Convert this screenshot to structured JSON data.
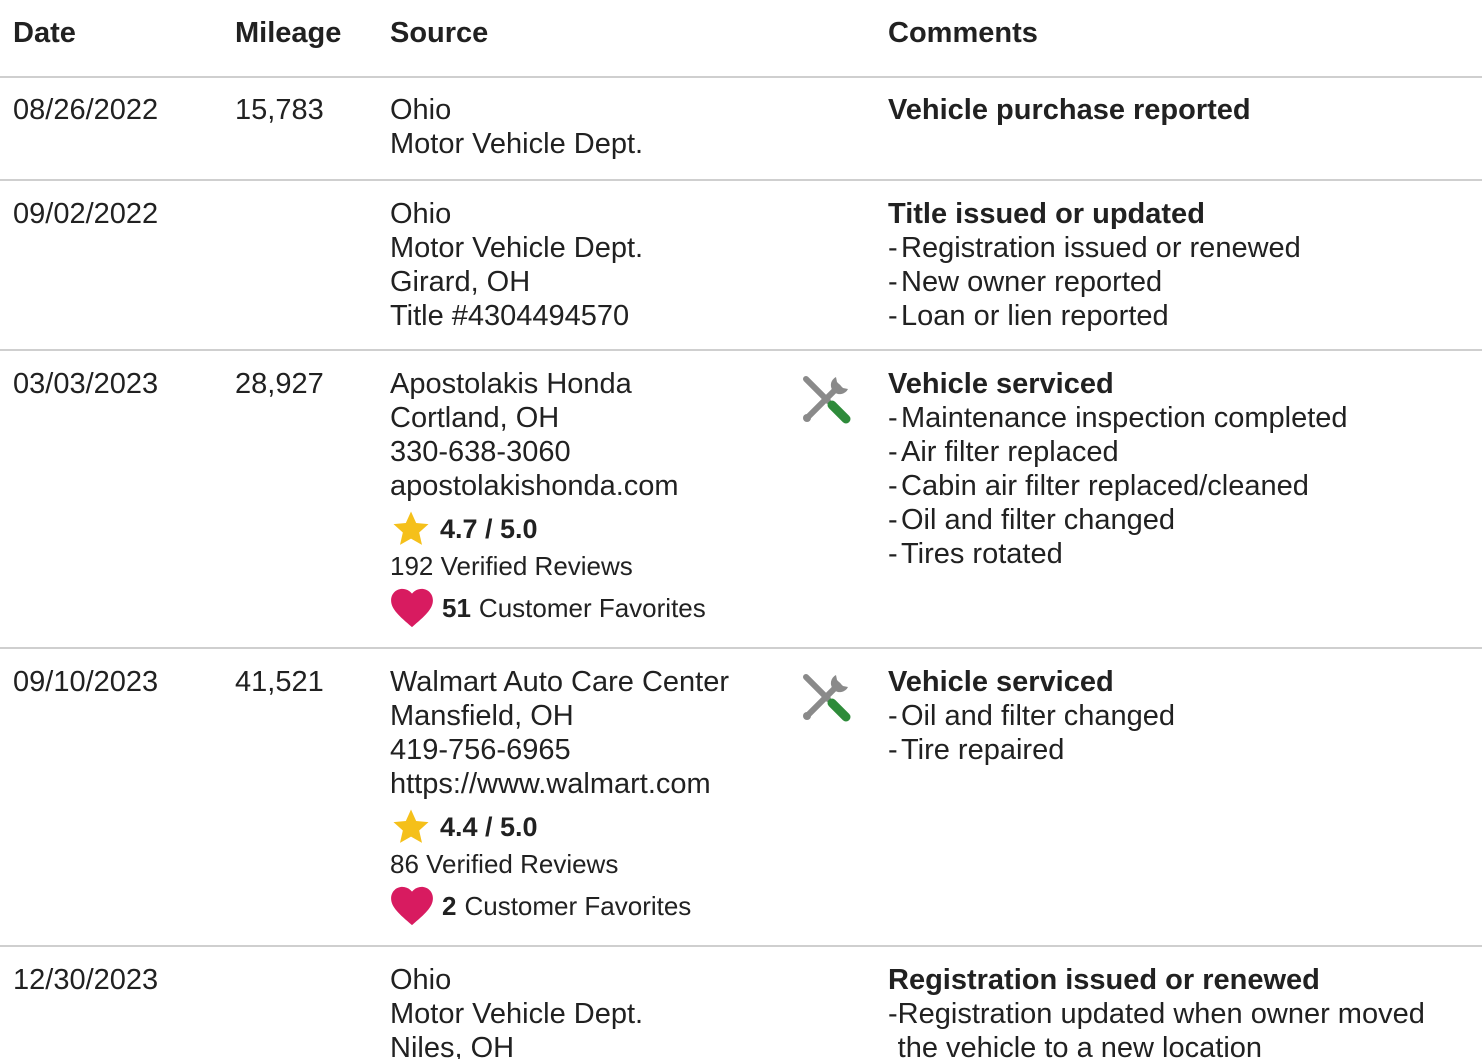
{
  "header": {
    "date": "Date",
    "mileage": "Mileage",
    "source": "Source",
    "comments": "Comments"
  },
  "rows": [
    {
      "date": "08/26/2022",
      "mileage": "15,783",
      "source": [
        "Ohio",
        "Motor Vehicle Dept."
      ],
      "comment_title": "Vehicle purchase reported",
      "comment_items": []
    },
    {
      "date": "09/02/2022",
      "mileage": "",
      "source": [
        "Ohio",
        "Motor Vehicle Dept.",
        "Girard, OH",
        "Title #4304494570"
      ],
      "comment_title": "Title issued or updated",
      "comment_items": [
        "Registration issued or renewed",
        "New owner reported",
        "Loan or lien reported"
      ]
    },
    {
      "date": "03/03/2023",
      "mileage": "28,927",
      "source": [
        "Apostolakis Honda",
        "Cortland, OH",
        "330-638-3060",
        "apostolakishonda.com"
      ],
      "rating": "4.7 / 5.0",
      "reviews": "192 Verified Reviews",
      "favorites_count": "51",
      "favorites_label": "Customer Favorites",
      "icon": "service-wrench-icon",
      "comment_title": "Vehicle serviced",
      "comment_items": [
        "Maintenance inspection completed",
        "Air filter replaced",
        "Cabin air filter replaced/cleaned",
        "Oil and filter changed",
        "Tires rotated"
      ]
    },
    {
      "date": "09/10/2023",
      "mileage": "41,521",
      "source": [
        "Walmart Auto Care Center",
        "Mansfield, OH",
        "419-756-6965",
        "https://www.walmart.com"
      ],
      "rating": "4.4 / 5.0",
      "reviews": "86 Verified Reviews",
      "favorites_count": "2",
      "favorites_label": "Customer Favorites",
      "icon": "service-wrench-icon",
      "comment_title": "Vehicle serviced",
      "comment_items": [
        "Oil and filter changed",
        "Tire repaired"
      ]
    },
    {
      "date": "12/30/2023",
      "mileage": "",
      "source": [
        "Ohio",
        "Motor Vehicle Dept.",
        "Niles, OH"
      ],
      "comment_title": "Registration issued or renewed",
      "comment_items": [
        "Registration updated when owner moved the vehicle to a new location"
      ]
    }
  ],
  "colors": {
    "star": "#f5c01a",
    "heart": "#d81b60",
    "wrench_gray": "#8a8a8a",
    "wrench_green": "#2e8b3a",
    "divider": "#cfcfcf"
  }
}
